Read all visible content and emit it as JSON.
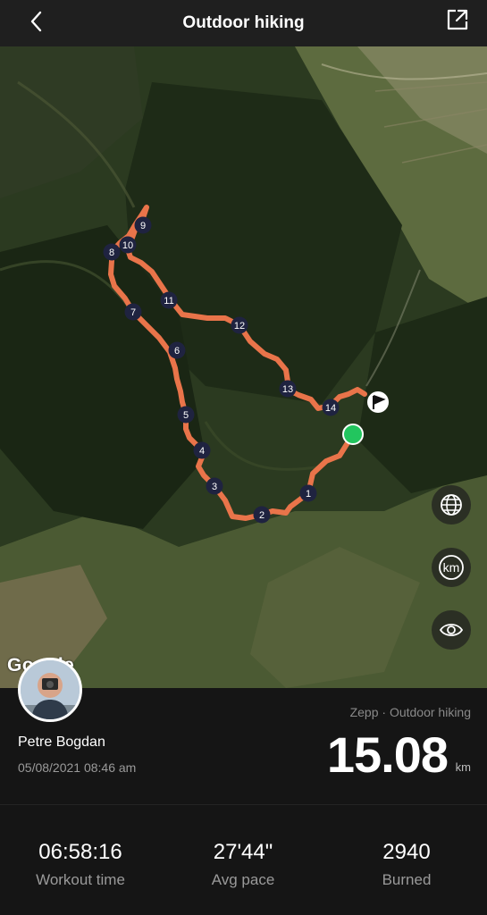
{
  "header": {
    "title": "Outdoor hiking"
  },
  "route": {
    "markers": [
      "1",
      "2",
      "3",
      "4",
      "5",
      "6",
      "7",
      "8",
      "9",
      "10",
      "11",
      "12",
      "13",
      "14"
    ]
  },
  "map": {
    "attribution": "Google",
    "km_label": "km"
  },
  "workout": {
    "user": "Petre Bogdan",
    "datetime": "05/08/2021 08:46 am",
    "source": "Zepp · Outdoor hiking",
    "distance": "15.08",
    "distance_unit": "km"
  },
  "stats": [
    {
      "value": "06:58:16",
      "label": "Workout time"
    },
    {
      "value": "27'44\"",
      "label": "Avg pace"
    },
    {
      "value": "2940",
      "label": "Burned"
    }
  ],
  "colors": {
    "route": "#e9744a",
    "start": "#22c55e",
    "marker": "#1f2340"
  }
}
